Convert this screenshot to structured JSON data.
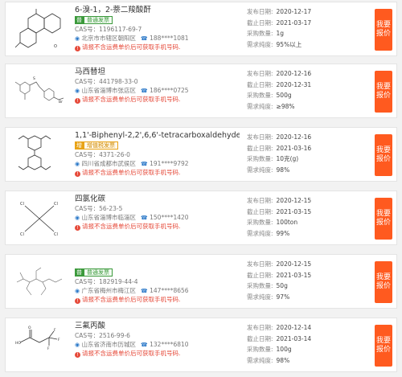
{
  "labels": {
    "publish_date": "发布日期:",
    "deadline": "截止日期:",
    "quantity": "采购数量:",
    "purity": "需求纯度:",
    "warning": "请报不含运费单价后可获取手机号码.",
    "quote_button": "我要报价"
  },
  "colors": {
    "accent": "#ff5a1f",
    "badge_green": "#3c9a3c",
    "badge_gold": "#e8a317",
    "warning_red": "#e64a3a",
    "location_blue": "#2a78c8"
  },
  "items": [
    {
      "name": "6-溴-1，2-萘二羧酸酐",
      "badge": {
        "tag": "普",
        "text": "普通发票",
        "style": "green"
      },
      "cas": "CAS号：1196117-69-7",
      "location": "北京市市辖区朝阳区",
      "phone": "188****1081",
      "publish_date": "2020-12-17",
      "deadline": "2021-03-17",
      "quantity": "1g",
      "purity": "95%以上"
    },
    {
      "name": "马西替坦",
      "badge": null,
      "cas": "CAS号：441798-33-0",
      "location": "山东省淄博市张店区",
      "phone": "186****0725",
      "publish_date": "2020-12-16",
      "deadline": "2020-12-31",
      "quantity": "500g",
      "purity": "≥98%"
    },
    {
      "name": "1,1'-Biphenyl-2,2',6,6'-tetracarboxaldehyde",
      "badge": {
        "tag": "增",
        "text": "增值税发票",
        "style": "gold"
      },
      "cas": "CAS号：4371-26-0",
      "location": "四川省成都市武侯区",
      "phone": "191****9792",
      "publish_date": "2020-12-16",
      "deadline": "2021-03-16",
      "quantity": "10克(g)",
      "purity": "98%"
    },
    {
      "name": "四氯化碳",
      "badge": null,
      "cas": "CAS号：56-23-5",
      "location": "山东省淄博市临淄区",
      "phone": "150****1420",
      "publish_date": "2020-12-15",
      "deadline": "2021-03-15",
      "quantity": "100ton",
      "purity": "99%"
    },
    {
      "name": "",
      "badge": {
        "tag": "普",
        "text": "普通发票",
        "style": "green"
      },
      "cas": "CAS号：182919-44-4",
      "location": "广东省梅州市梅江区",
      "phone": "147****8656",
      "publish_date": "2020-12-15",
      "deadline": "2021-03-15",
      "quantity": "50g",
      "purity": "97%"
    },
    {
      "name": "三氟丙酸",
      "badge": null,
      "cas": "CAS号：2516-99-6",
      "location": "山东省济南市历城区",
      "phone": "132****6810",
      "publish_date": "2020-12-14",
      "deadline": "2021-03-14",
      "quantity": "100g",
      "purity": "98%"
    }
  ]
}
